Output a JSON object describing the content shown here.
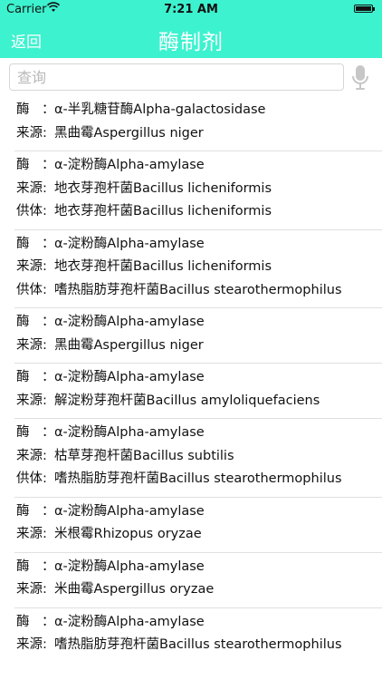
{
  "status": {
    "carrier": "Carrier",
    "time": "7:21 AM"
  },
  "nav": {
    "back": "返回",
    "title": "酶制剂"
  },
  "search": {
    "placeholder": "查询",
    "value": ""
  },
  "labels": {
    "enzyme": "酶",
    "colon": "：",
    "source": "来源:",
    "donor": "供体:"
  },
  "colors": {
    "accent": "#3df2cf"
  },
  "items": [
    {
      "enzyme": "α-半乳糖苷酶Alpha-galactosidase",
      "source": "黑曲霉Aspergillus niger"
    },
    {
      "enzyme": "α-淀粉酶Alpha-amylase",
      "source": "地衣芽孢杆菌Bacillus licheniformis",
      "donor": "地衣芽孢杆菌Bacillus licheniformis"
    },
    {
      "enzyme": "α-淀粉酶Alpha-amylase",
      "source": "地衣芽孢杆菌Bacillus licheniformis",
      "donor": "嗜热脂肪芽孢杆菌Bacillus stearothermophilus"
    },
    {
      "enzyme": "α-淀粉酶Alpha-amylase",
      "source": "黑曲霉Aspergillus niger"
    },
    {
      "enzyme": "α-淀粉酶Alpha-amylase",
      "source": "解淀粉芽孢杆菌Bacillus amyloliquefaciens"
    },
    {
      "enzyme": "α-淀粉酶Alpha-amylase",
      "source": "枯草芽孢杆菌Bacillus subtilis",
      "donor": "嗜热脂肪芽孢杆菌Bacillus stearothermophilus"
    },
    {
      "enzyme": "α-淀粉酶Alpha-amylase",
      "source": "米根霉Rhizopus oryzae"
    },
    {
      "enzyme": "α-淀粉酶Alpha-amylase",
      "source": "米曲霉Aspergillus oryzae"
    },
    {
      "enzyme": "α-淀粉酶Alpha-amylase",
      "source": "嗜热脂肪芽孢杆菌Bacillus stearothermophilus"
    }
  ]
}
